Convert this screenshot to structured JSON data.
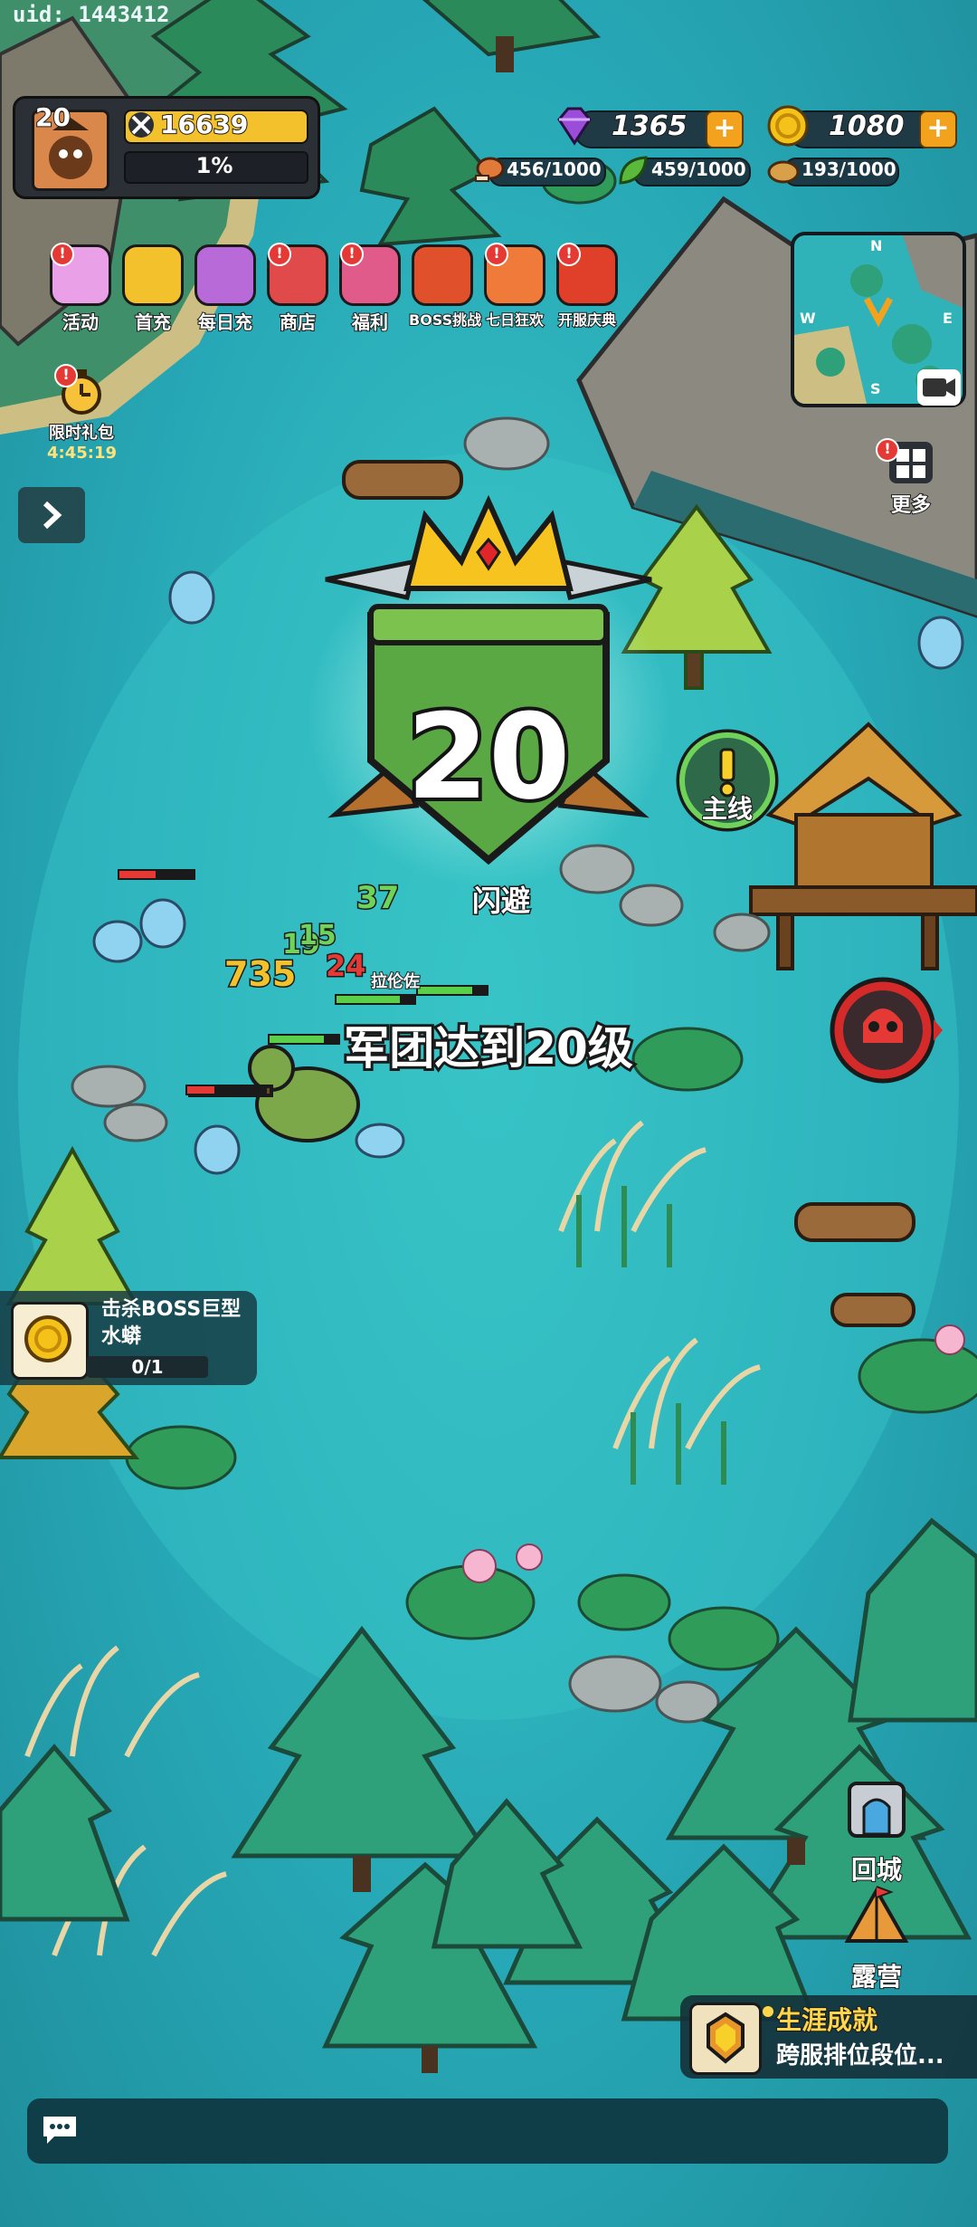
{
  "uid_label": "uid: 1443412",
  "player": {
    "level": "20",
    "power": "16639",
    "exp_percent": "1%"
  },
  "resources": {
    "gems": "1365",
    "gold": "1080",
    "meat": "456/1000",
    "wood": "459/1000",
    "bread": "193/1000"
  },
  "activities": [
    {
      "label": "活动",
      "icon": "event-icon",
      "badge": "!"
    },
    {
      "label": "首充",
      "icon": "first-recharge-icon",
      "badge": ""
    },
    {
      "label": "每日充",
      "icon": "daily-recharge-icon",
      "badge": ""
    },
    {
      "label": "商店",
      "icon": "shop-icon",
      "badge": "!"
    },
    {
      "label": "福利",
      "icon": "gift-icon",
      "badge": "!"
    },
    {
      "label": "BOSS挑战",
      "icon": "boss-challenge-icon",
      "badge": ""
    },
    {
      "label": "七日狂欢",
      "icon": "seven-day-icon",
      "badge": "!"
    },
    {
      "label": "开服庆典",
      "icon": "server-celebration-icon",
      "badge": "!"
    }
  ],
  "limited_gift": {
    "label": "限时礼包",
    "timer": "4:45:19"
  },
  "more_label": "更多",
  "compass": {
    "n": "N",
    "e": "E",
    "s": "S",
    "w": "W"
  },
  "level_up": {
    "level": "20",
    "message": "军团达到20级"
  },
  "dodge_text": "闪避",
  "combat_numbers": {
    "heal_a": "37",
    "heal_b": "19",
    "heal_c": "15",
    "damage_a": "735",
    "damage_b": "24",
    "ally_name": "拉伦佐"
  },
  "main_quest_label": "主线",
  "quest": {
    "title": "击杀BOSS巨型水蟒",
    "progress": "0/1"
  },
  "return_city_label": "回城",
  "camp_label": "露营",
  "achievement": {
    "title": "生涯成就",
    "subtitle": "跨服排位段位..."
  },
  "colors": {
    "water": "#2fb7c0",
    "gold": "#f2a21d",
    "gem": "#9a4dd8",
    "alert": "#e53935"
  }
}
